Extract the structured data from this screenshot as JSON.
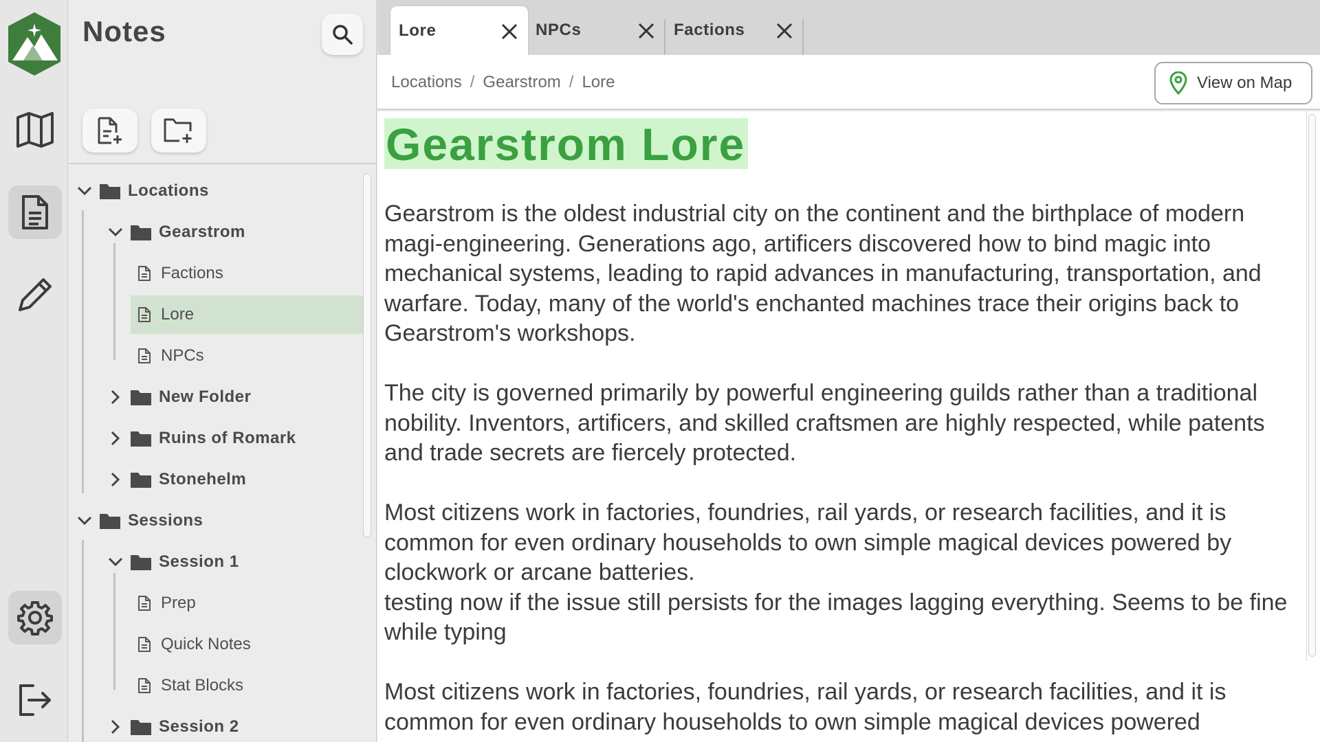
{
  "rail": {
    "icons": [
      "app-logo",
      "map-icon",
      "notes-icon",
      "pencil-icon",
      "settings-icon",
      "logout-icon"
    ],
    "active": "notes-icon",
    "logo_color": "#3f7d3c"
  },
  "notes": {
    "title": "Notes",
    "tree": {
      "locations": "Locations",
      "gearstrom": "Gearstrom",
      "factions": "Factions",
      "lore": "Lore",
      "npcs": "NPCs",
      "new_folder": "New Folder",
      "ruins": "Ruins of Romark",
      "stonehelm": "Stonehelm",
      "sessions": "Sessions",
      "session1": "Session 1",
      "prep": "Prep",
      "quick_notes": "Quick Notes",
      "stat_blocks": "Stat Blocks",
      "session2": "Session 2"
    },
    "selected": "Lore",
    "selected_color": "#d2e2d0"
  },
  "tabs": [
    {
      "label": "Lore",
      "active": true
    },
    {
      "label": "NPCs",
      "active": false
    },
    {
      "label": "Factions",
      "active": false
    }
  ],
  "breadcrumb": [
    "Locations",
    "Gearstrom",
    "Lore"
  ],
  "breadcrumb_sep": "/",
  "map_button": "View on Map",
  "doc": {
    "title": "Gearstrom Lore",
    "title_color": "#3aa040",
    "title_highlight": "#d0f5cd",
    "paragraphs": [
      "Gearstrom is the oldest industrial city on the continent and the birthplace of modern magi-engineering. Generations ago, artificers discovered how to bind magic into mechanical systems, leading to rapid advances in manufacturing, transportation, and warfare. Today, many of the world's enchanted machines trace their origins back to Gearstrom's workshops.",
      "The city is governed primarily by powerful engineering guilds rather than a traditional nobility. Inventors, artificers, and skilled craftsmen are highly respected, while patents and trade secrets are fiercely protected.",
      "Most citizens work in factories, foundries, rail yards, or research facilities, and it is common for even ordinary households to own simple magical devices powered by clockwork or arcane batteries.",
      "testing now if the issue still persists for the images lagging everything. Seems to be fine while typing",
      "Most citizens work in factories, foundries, rail yards, or research facilities, and it is common for even ordinary households to own simple magical devices powered"
    ]
  }
}
